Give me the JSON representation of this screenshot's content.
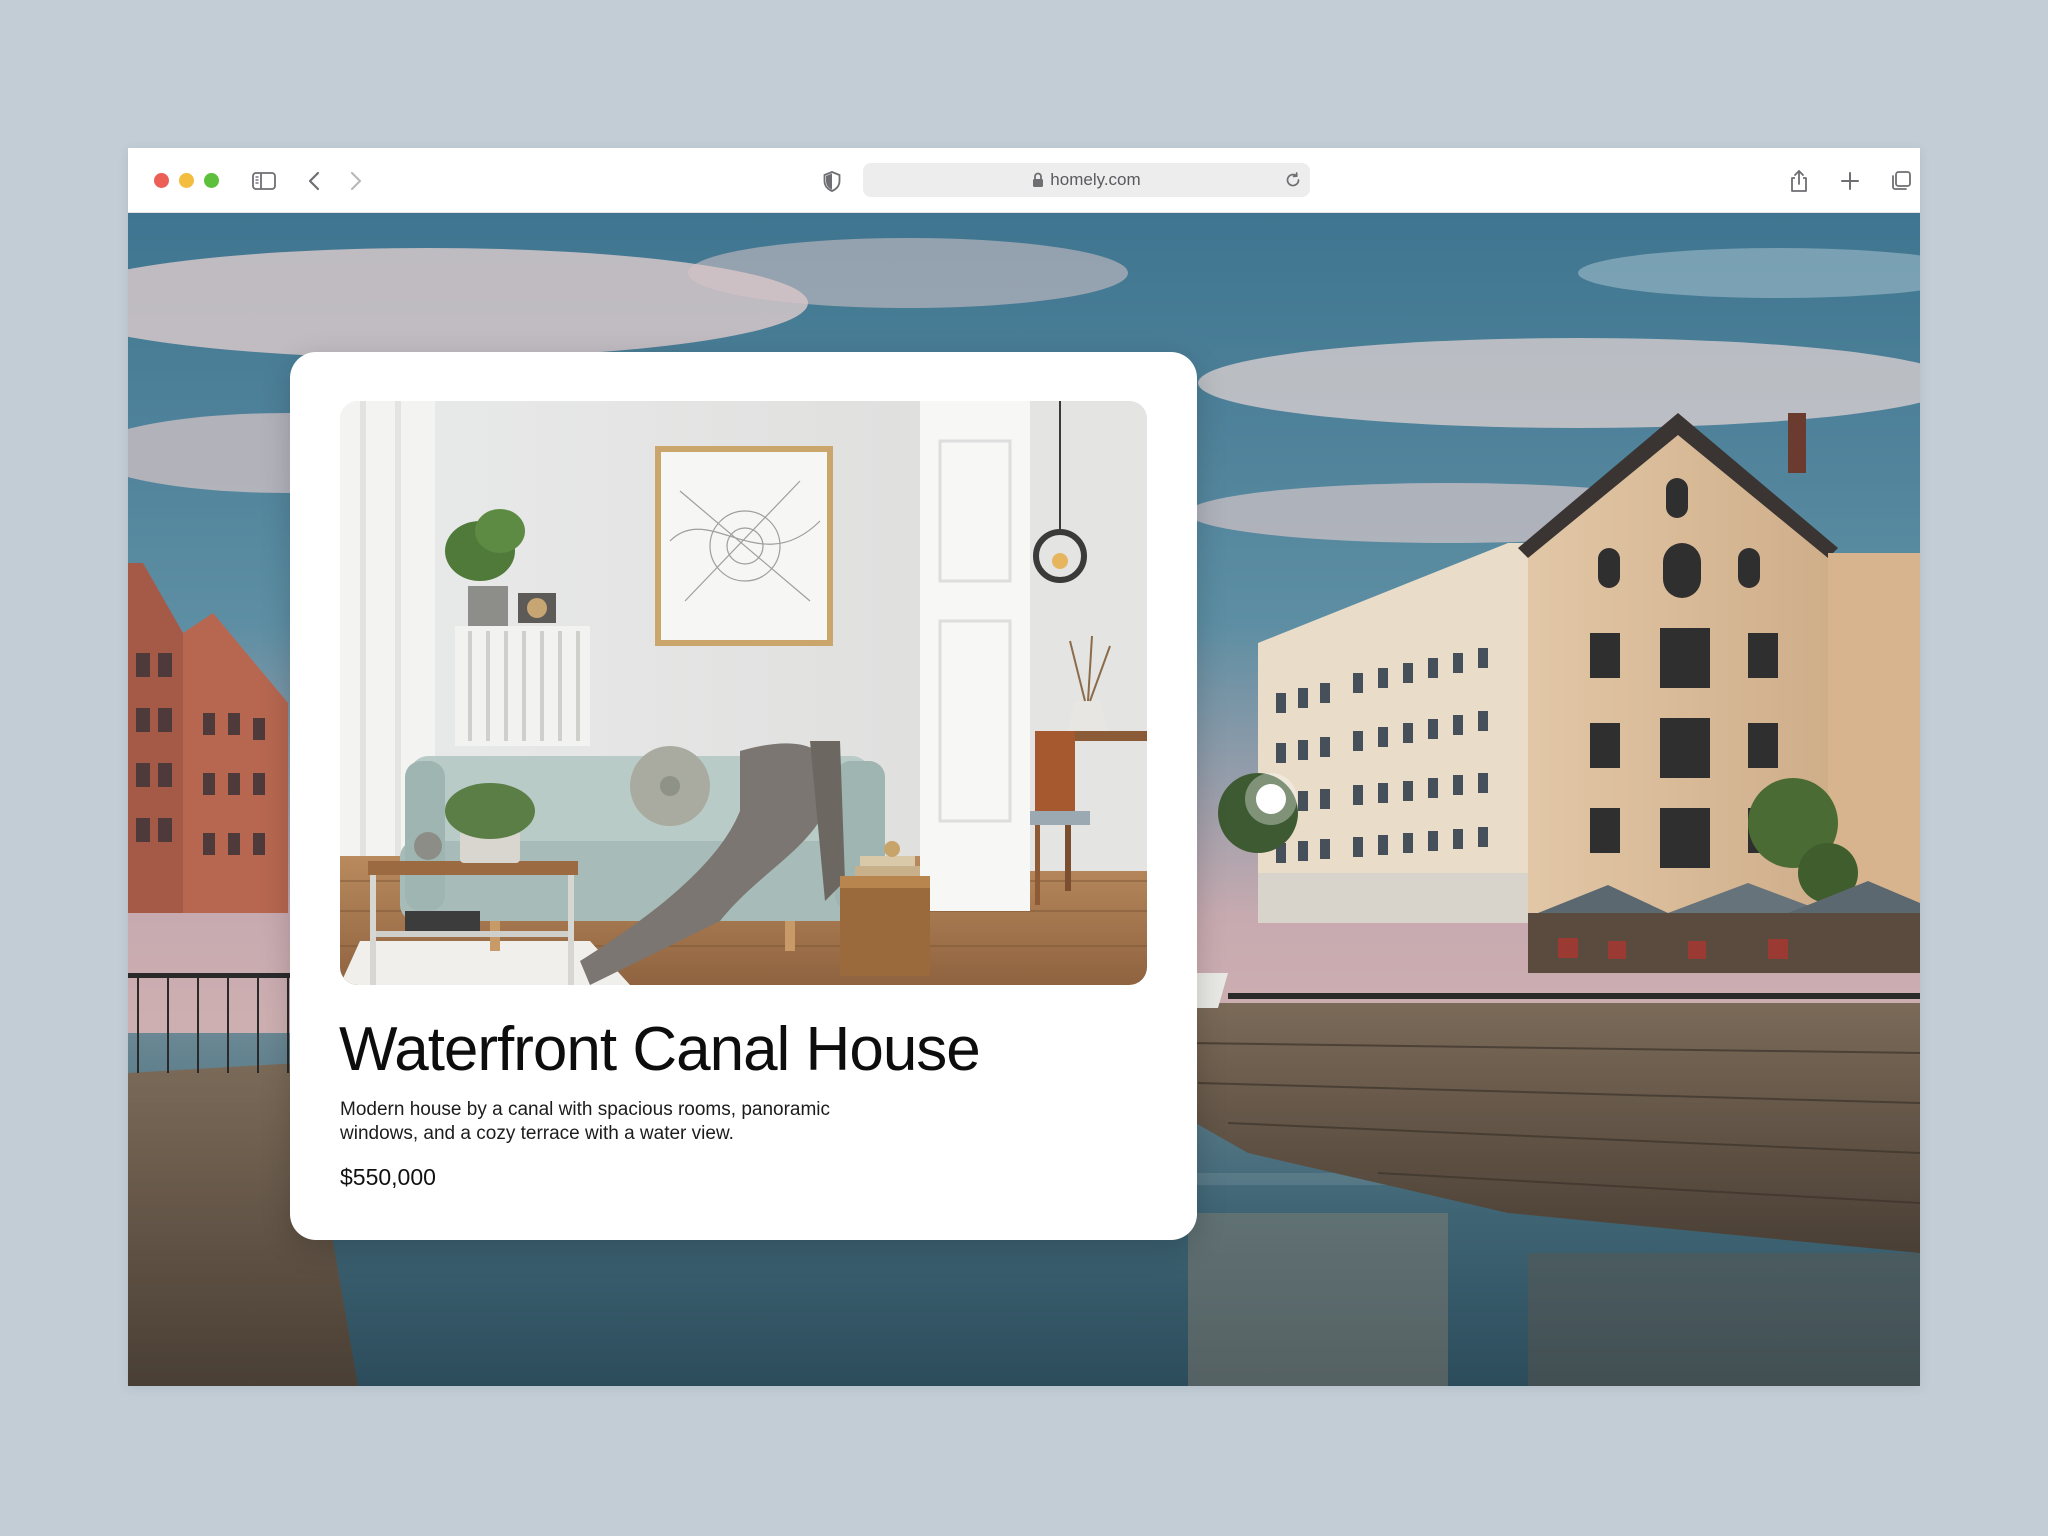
{
  "browser": {
    "url": "homely.com"
  },
  "listing": {
    "title": "Waterfront Canal House",
    "description": "Modern house by a canal with spacious rooms, panoramic windows, and a cozy terrace with a water view.",
    "price": "$550,000"
  },
  "icons": {
    "toolbar_left": [
      "sidebar-icon",
      "chevron-left-icon",
      "chevron-right-icon"
    ],
    "toolbar_center": [
      "shield-icon",
      "lock-icon",
      "reload-icon"
    ],
    "toolbar_right": [
      "share-icon",
      "plus-icon",
      "tabs-icon"
    ]
  },
  "colors": {
    "page_background": "#c3cdd5",
    "card_background": "#ffffff",
    "address_bar": "#ededee",
    "traffic_red": "#ec5f57",
    "traffic_yellow": "#f3bd3f",
    "traffic_green": "#5dc03d"
  }
}
